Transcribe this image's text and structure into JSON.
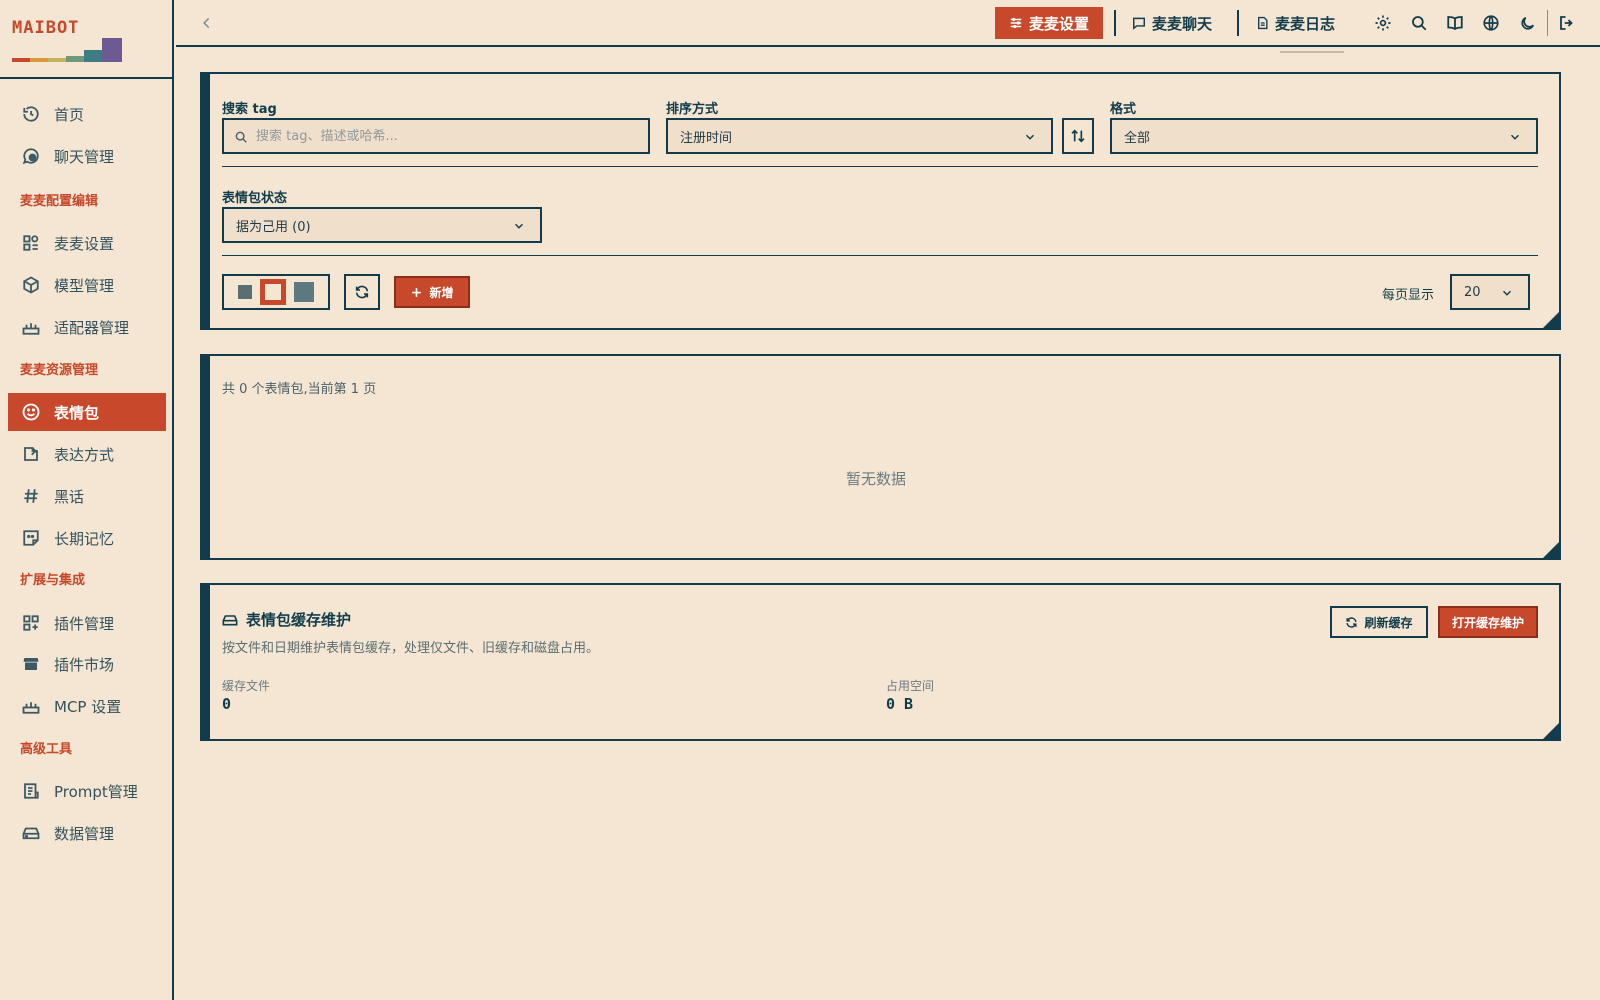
{
  "brand": {
    "name": "MAIBOT"
  },
  "sidebar": {
    "groups": [
      {
        "title": ""
      },
      {
        "title": "麦麦配置编辑"
      },
      {
        "title": "麦麦资源管理"
      },
      {
        "title": "扩展与集成"
      },
      {
        "title": "高级工具"
      }
    ],
    "items": [
      {
        "label": "首页",
        "icon": "history-icon"
      },
      {
        "label": "聊天管理",
        "icon": "chat-icon"
      },
      {
        "label": "麦麦设置",
        "icon": "settings-grid-icon"
      },
      {
        "label": "模型管理",
        "icon": "cube-icon"
      },
      {
        "label": "适配器管理",
        "icon": "router-icon"
      },
      {
        "label": "表情包",
        "icon": "smile-icon",
        "active": true
      },
      {
        "label": "表达方式",
        "icon": "edit-note-icon"
      },
      {
        "label": "黑话",
        "icon": "hash-icon"
      },
      {
        "label": "长期记忆",
        "icon": "sticky-note-icon"
      },
      {
        "label": "插件管理",
        "icon": "grid-plus-icon"
      },
      {
        "label": "插件市场",
        "icon": "store-icon"
      },
      {
        "label": "MCP 设置",
        "icon": "router-icon"
      },
      {
        "label": "Prompt管理",
        "icon": "document-list-icon"
      },
      {
        "label": "数据管理",
        "icon": "drive-icon"
      }
    ]
  },
  "topbar": {
    "settings_label": "麦麦设置",
    "chat_label": "麦麦聊天",
    "log_label": "麦麦日志",
    "icons": [
      "gear-icon",
      "search-icon",
      "book-icon",
      "globe-icon",
      "moon-icon",
      "logout-icon"
    ]
  },
  "filters": {
    "search_label": "搜索 tag",
    "search_placeholder": "搜索 tag、描述或哈希...",
    "sort_label": "排序方式",
    "sort_value": "注册时间",
    "format_label": "格式",
    "format_value": "全部",
    "status_label": "表情包状态",
    "status_value": "据为己用 (0)",
    "add_label": "新增",
    "page_size_label": "每页显示",
    "page_size_value": "20"
  },
  "list": {
    "summary": "共 0 个表情包,当前第 1 页",
    "empty": "暂无数据"
  },
  "maintenance": {
    "title": "表情包缓存维护",
    "desc": "按文件和日期维护表情包缓存，处理仅文件、旧缓存和磁盘占用。",
    "refresh_label": "刷新缓存",
    "open_label": "打开缓存维护",
    "files_label": "缓存文件",
    "files_value": "0",
    "space_label": "占用空间",
    "space_value": "0 B"
  },
  "colors": {
    "accent": "#c7482a",
    "ink": "#123c4b",
    "background": "#f4e6d3"
  }
}
